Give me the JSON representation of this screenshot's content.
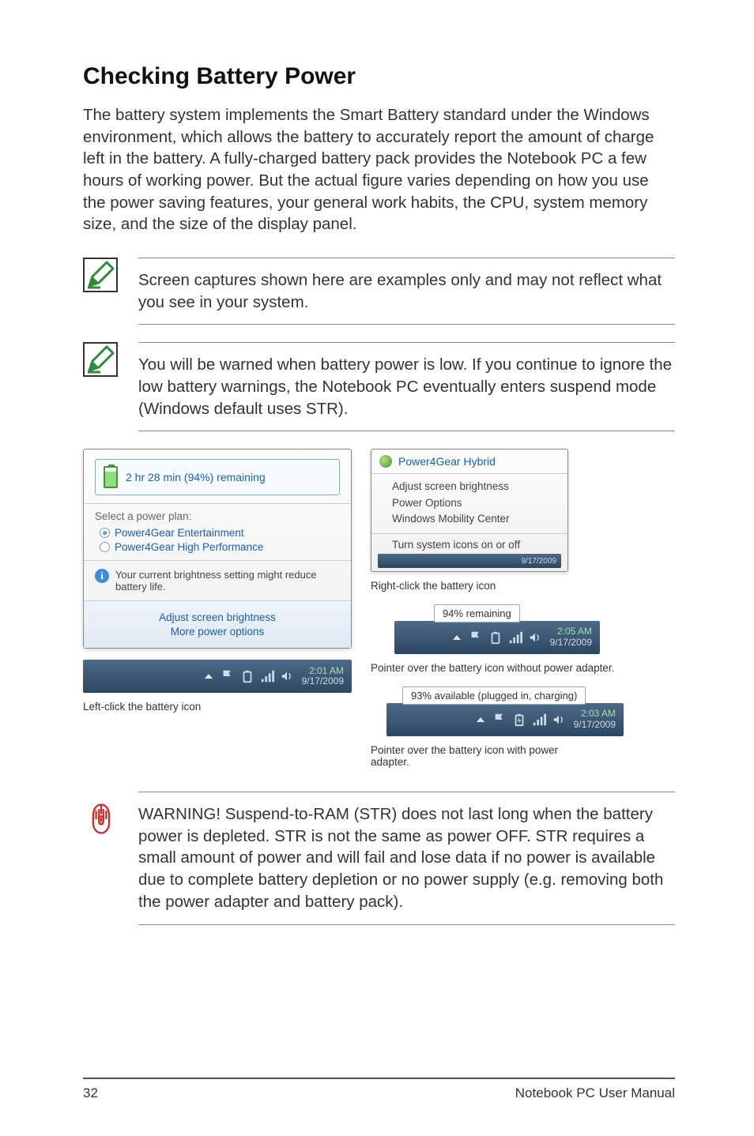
{
  "title": "Checking Battery Power",
  "intro": "The battery system implements the Smart Battery standard under the Windows environment, which allows the battery to accurately report the amount of charge left in the battery. A fully-charged battery pack provides the Notebook PC a few hours of working power. But the actual figure varies depending on how you use the power saving features, your general work habits, the CPU, system memory size, and the size of the display panel.",
  "note1": "Screen captures shown here are examples only and may not reflect what you see in your system.",
  "note2": "You will be warned when battery power is low. If you continue to ignore the low battery warnings, the Notebook PC eventually enters suspend mode (Windows default uses STR).",
  "left_popup": {
    "remaining": "2 hr 28 min (94%) remaining",
    "plan_label": "Select a power plan:",
    "plans": [
      {
        "label": "Power4Gear Entertainment",
        "selected": true
      },
      {
        "label": "Power4Gear High Performance",
        "selected": false
      }
    ],
    "info": "Your current brightness setting might reduce battery life.",
    "action1": "Adjust screen brightness",
    "action2": "More power options",
    "taskbar": {
      "time": "2:01 AM",
      "date": "9/17/2009"
    },
    "caption": "Left-click the battery icon"
  },
  "ctx_menu": {
    "title": "Power4Gear Hybrid",
    "items": [
      "Adjust screen brightness",
      "Power Options",
      "Windows Mobility Center"
    ],
    "footer": "Turn system icons on or off",
    "strip_date": "9/17/2009",
    "caption": "Right-click the battery icon"
  },
  "tooltip1": {
    "label": "94% remaining",
    "time": "2:05 AM",
    "date": "9/17/2009",
    "caption": "Pointer over the battery icon without power adapter."
  },
  "tooltip2": {
    "label": "93% available (plugged in, charging)",
    "time": "2:03 AM",
    "date": "9/17/2009",
    "caption": "Pointer over the battery icon with power adapter."
  },
  "warning": "WARNING!  Suspend-to-RAM (STR) does not last long when the battery power is depleted. STR is not the same as power OFF. STR requires a small amount of power and will fail and lose data if no power is available due to complete battery depletion or no power supply (e.g. removing both the power adapter and battery pack).",
  "footer": {
    "page": "32",
    "label": "Notebook PC User Manual"
  }
}
